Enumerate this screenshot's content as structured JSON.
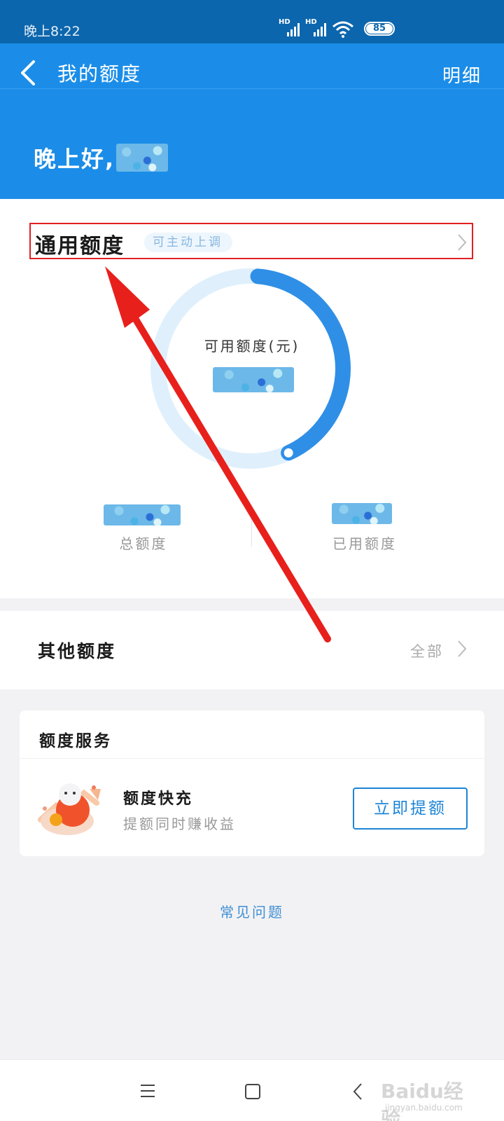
{
  "status_bar": {
    "time": "晚上8:22",
    "signal_labels": [
      "HD",
      "HD"
    ],
    "battery": "85"
  },
  "header": {
    "title": "我的额度",
    "detail_link": "明细",
    "greeting": "晚上好,",
    "background_color": "#1b8de8"
  },
  "quota": {
    "title": "通用额度",
    "tag": "可主动上调",
    "ring_label": "可用额度(元)",
    "total_label": "总额度",
    "used_label": "已用额度",
    "ring_fill_fraction": 0.42,
    "accent_color": "#2f8fe6"
  },
  "other": {
    "title": "其他额度",
    "all_link": "全部"
  },
  "service": {
    "section_title": "额度服务",
    "item_name": "额度快充",
    "item_desc": "提额同时赚收益",
    "button_label": "立即提额"
  },
  "faq_link": "常见问题",
  "nav": {
    "icons": [
      "menu-icon",
      "home-icon",
      "back-icon"
    ]
  },
  "watermark": {
    "main": "Baidu经验",
    "sub": "jingyan.baidu.com"
  },
  "annotation": {
    "color": "#e8201c"
  }
}
